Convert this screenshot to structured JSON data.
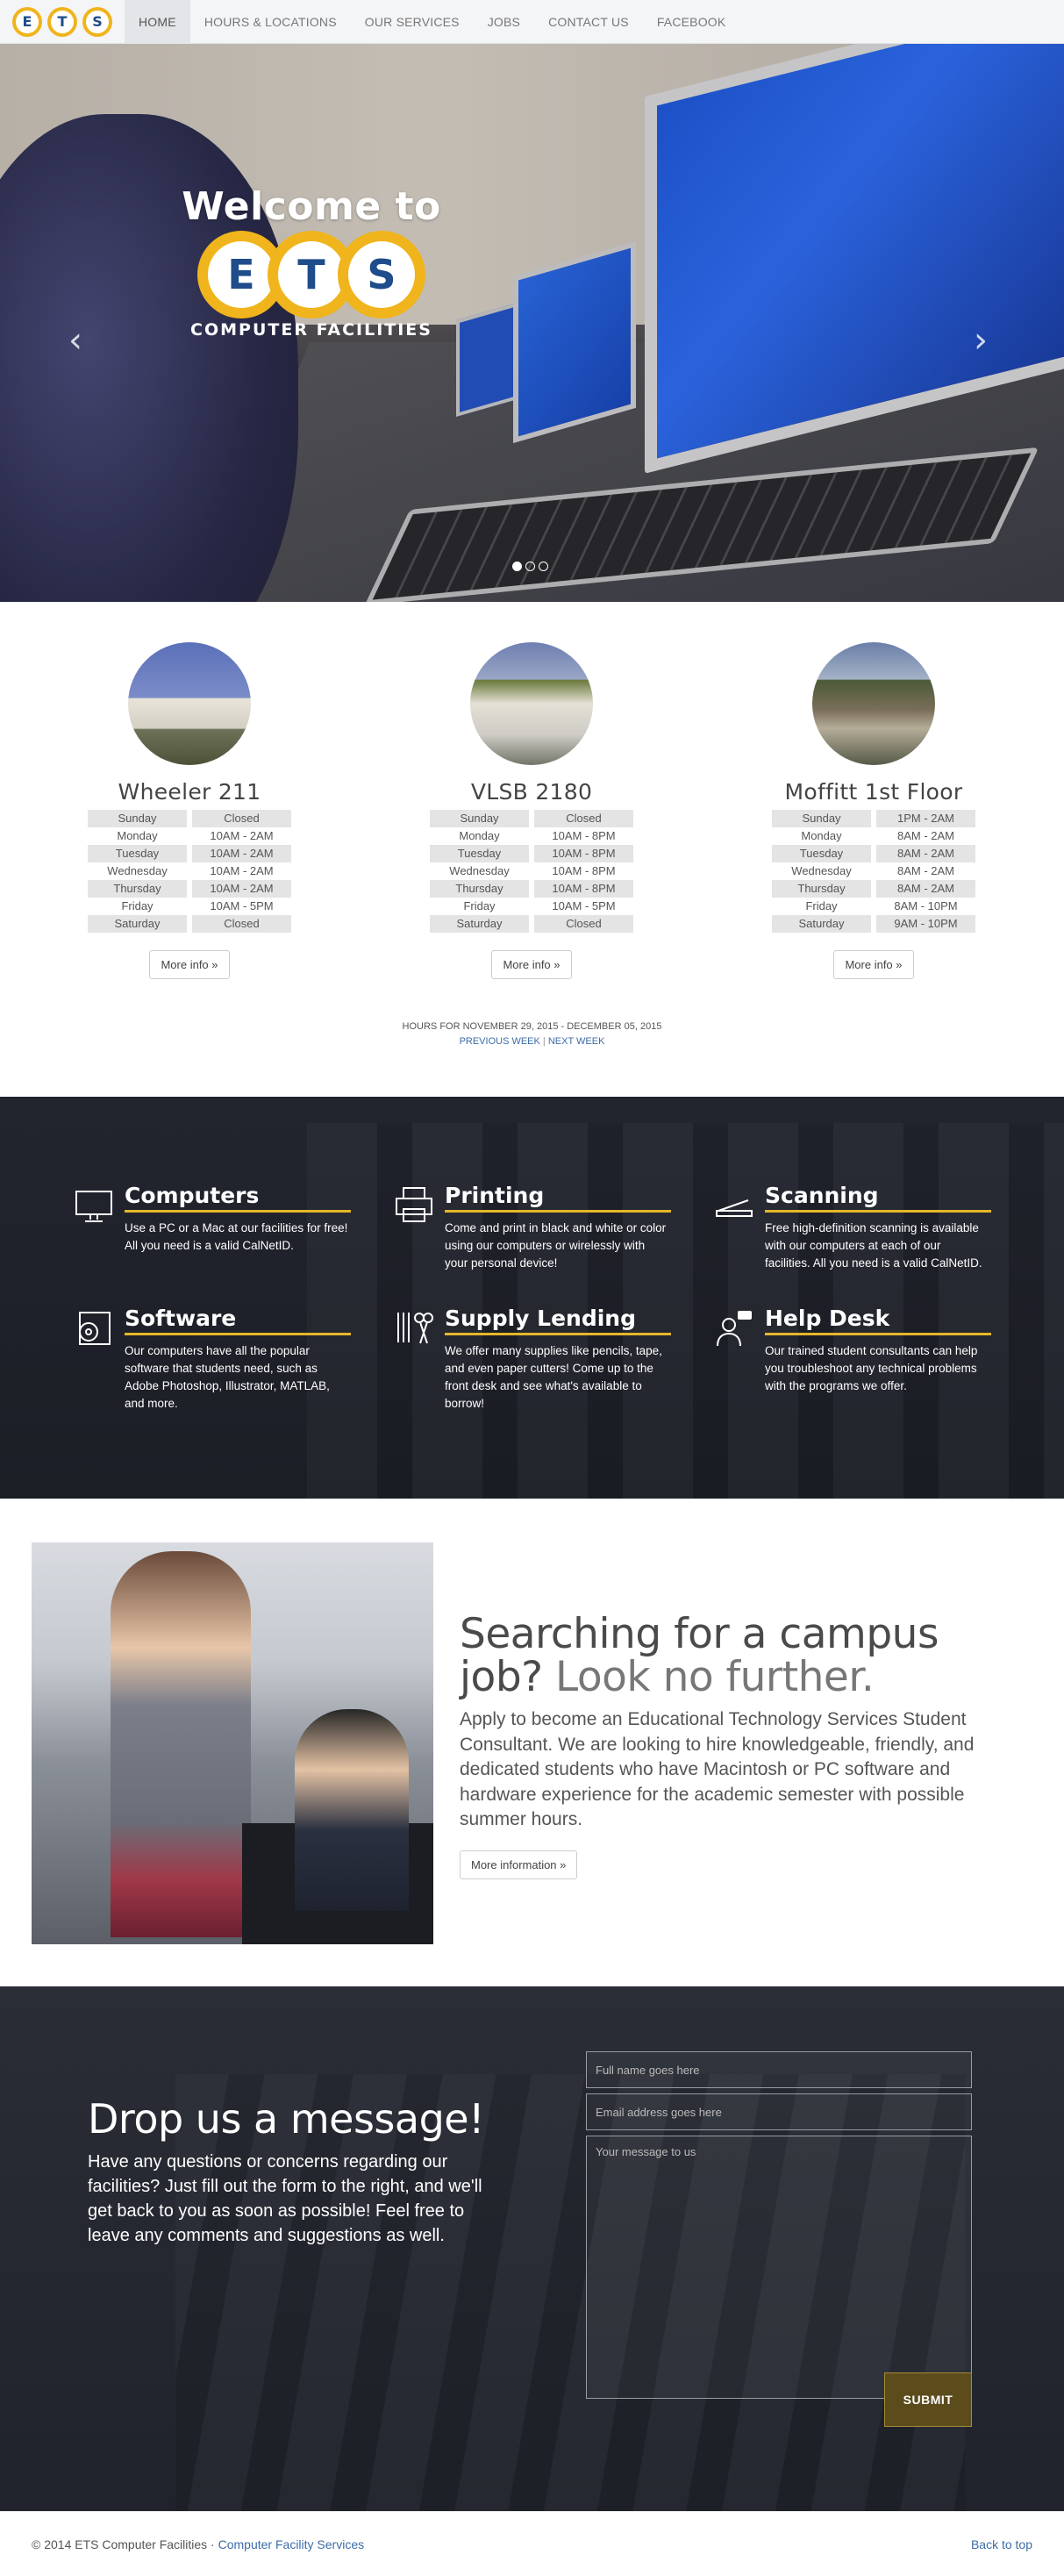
{
  "nav": {
    "logo_letters": [
      "E",
      "T",
      "S"
    ],
    "items": [
      "HOME",
      "HOURS & LOCATIONS",
      "OUR SERVICES",
      "JOBS",
      "CONTACT US",
      "FACEBOOK"
    ]
  },
  "hero": {
    "welcome": "Welcome to",
    "logo_letters": [
      "E",
      "T",
      "S"
    ],
    "subtitle": "COMPUTER FACILITIES",
    "prev": "‹",
    "next": "›",
    "slides": 3
  },
  "locations": [
    {
      "name": "Wheeler 211",
      "hours": [
        [
          "Sunday",
          "Closed"
        ],
        [
          "Monday",
          "10AM - 2AM"
        ],
        [
          "Tuesday",
          "10AM - 2AM"
        ],
        [
          "Wednesday",
          "10AM - 2AM"
        ],
        [
          "Thursday",
          "10AM - 2AM"
        ],
        [
          "Friday",
          "10AM - 5PM"
        ],
        [
          "Saturday",
          "Closed"
        ]
      ],
      "button": "More info »"
    },
    {
      "name": "VLSB 2180",
      "hours": [
        [
          "Sunday",
          "Closed"
        ],
        [
          "Monday",
          "10AM - 8PM"
        ],
        [
          "Tuesday",
          "10AM - 8PM"
        ],
        [
          "Wednesday",
          "10AM - 8PM"
        ],
        [
          "Thursday",
          "10AM - 8PM"
        ],
        [
          "Friday",
          "10AM - 5PM"
        ],
        [
          "Saturday",
          "Closed"
        ]
      ],
      "button": "More info »"
    },
    {
      "name": "Moffitt 1st Floor",
      "hours": [
        [
          "Sunday",
          "1PM - 2AM"
        ],
        [
          "Monday",
          "8AM - 2AM"
        ],
        [
          "Tuesday",
          "8AM - 2AM"
        ],
        [
          "Wednesday",
          "8AM - 2AM"
        ],
        [
          "Thursday",
          "8AM - 2AM"
        ],
        [
          "Friday",
          "8AM - 10PM"
        ],
        [
          "Saturday",
          "9AM - 10PM"
        ]
      ],
      "button": "More info »"
    }
  ],
  "week": {
    "label": "HOURS FOR NOVEMBER 29, 2015 - DECEMBER 05, 2015",
    "prev": "PREVIOUS WEEK",
    "sep": "|",
    "next": "NEXT WEEK"
  },
  "services": [
    {
      "icon": "monitor-icon",
      "title": "Computers",
      "text": "Use a PC or a Mac at our facilities for free! All you need is a valid CalNetID."
    },
    {
      "icon": "printer-icon",
      "title": "Printing",
      "text": "Come and print in black and white or color using our computers or wirelessly with your personal device!"
    },
    {
      "icon": "scanner-icon",
      "title": "Scanning",
      "text": "Free high-definition scanning is available with our computers at each of our facilities. All you need is a valid CalNetID."
    },
    {
      "icon": "software-disc-icon",
      "title": "Software",
      "text": "Our computers have all the popular software that students need, such as Adobe Photoshop, Illustrator, MATLAB, and more."
    },
    {
      "icon": "scissors-tools-icon",
      "title": "Supply Lending",
      "text": "We offer many supplies like pencils, tape, and even paper cutters! Come up to the front desk and see what's available to borrow!"
    },
    {
      "icon": "help-desk-person-icon",
      "title": "Help Desk",
      "text": "Our trained student consultants can help you troubleshoot any technical problems with the programs we offer."
    }
  ],
  "jobs": {
    "heading_a": "Searching for a campus job?",
    "heading_b": "Look no further.",
    "text": "Apply to become an Educational Technology Services Student Consultant. We are looking to hire knowledgeable, friendly, and dedicated students who have Macintosh or PC software and hardware experience for the academic semester with possible summer hours.",
    "button": "More information »"
  },
  "contact": {
    "heading": "Drop us a message!",
    "text": "Have any questions or concerns regarding our facilities? Just fill out the form to the right, and we'll get back to you as soon as possible! Feel free to leave any comments and suggestions as well.",
    "name_placeholder": "Full name goes here",
    "email_placeholder": "Email address goes here",
    "message_placeholder": "Your message to us",
    "submit": "SUBMIT"
  },
  "footer": {
    "copyright": "© 2014 ETS Computer Facilities · ",
    "link": "Computer Facility Services",
    "back": "Back to top"
  }
}
